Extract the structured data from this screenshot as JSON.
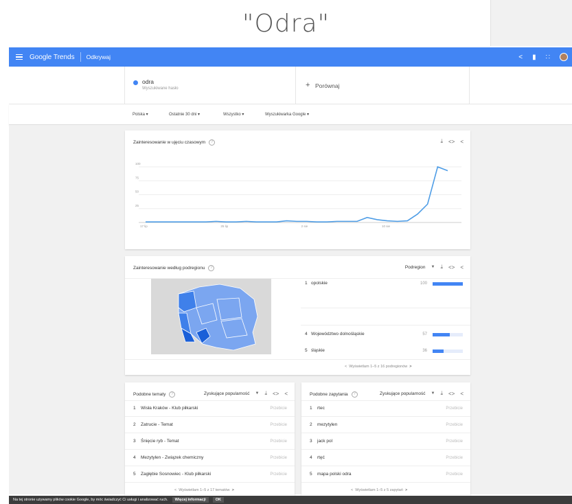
{
  "slide_title": "\"Odra\"",
  "app": {
    "brand": "Google Trends",
    "section": "Odkrywaj"
  },
  "search": {
    "term": "odra",
    "term_type": "Wyszukiwane hasło",
    "compare_label": "Porównaj"
  },
  "filters": {
    "region": "Polska ▾",
    "period": "Ostatnie 30 dni ▾",
    "category": "Wszystko ▾",
    "source": "Wyszukiwarka Google ▾"
  },
  "time_card": {
    "title": "Zainteresowanie w ujęciu czasowym"
  },
  "chart_data": {
    "type": "line",
    "x_tick_labels": [
      "17 lip",
      "25 lip",
      "2 sie",
      "10 sie"
    ],
    "y_tick_labels": [
      "100",
      "75",
      "50",
      "25"
    ],
    "ylim": [
      0,
      100
    ],
    "grid": true,
    "series": [
      {
        "color": "#4e9de6",
        "values": [
          1,
          1,
          1,
          1,
          1,
          1,
          1,
          2,
          1,
          1,
          2,
          1,
          1,
          1,
          3,
          2,
          2,
          1,
          1,
          2,
          2,
          2,
          9,
          5,
          3,
          2,
          3,
          15,
          33,
          100,
          93
        ]
      }
    ]
  },
  "region_card": {
    "title": "Zainteresowanie według podregionu",
    "mode_label": "Podregion",
    "rows": [
      {
        "rank": "1",
        "name": "opolskie",
        "value": "100",
        "fraction": 1.0
      },
      {
        "rank": "4",
        "name": "Województwo dolnośląskie",
        "value": "57",
        "fraction": 0.57
      },
      {
        "rank": "5",
        "name": "śląskie",
        "value": "36",
        "fraction": 0.36
      }
    ],
    "pager": "Wyświetlam 1–5 z 16 podregionów"
  },
  "topics_card": {
    "title": "Podobne tematy",
    "mode_label": "Zyskujące popularność",
    "rows": [
      {
        "rank": "1",
        "name": "Wisła Kraków - Klub piłkarski",
        "badge": "Przebicie"
      },
      {
        "rank": "2",
        "name": "Zatrucie - Temat",
        "badge": "Przebicie"
      },
      {
        "rank": "3",
        "name": "Śnięcie ryb - Temat",
        "badge": "Przebicie"
      },
      {
        "rank": "4",
        "name": "Mezytylen - Związek chemiczny",
        "badge": "Przebicie"
      },
      {
        "rank": "5",
        "name": "Zagłębie Sosnowiec - Klub piłkarski",
        "badge": "Przebicie"
      }
    ],
    "pager": "Wyświetlam 1–5 z 17 tematów"
  },
  "queries_card": {
    "title": "Podobne zapytania",
    "mode_label": "Zyskujące popularność",
    "rows": [
      {
        "rank": "1",
        "name": "rtec",
        "badge": "Przebicie"
      },
      {
        "rank": "2",
        "name": "mezytylen",
        "badge": "Przebicie"
      },
      {
        "rank": "3",
        "name": "jack pol",
        "badge": "Przebicie"
      },
      {
        "rank": "4",
        "name": "rtęć",
        "badge": "Przebicie"
      },
      {
        "rank": "5",
        "name": "mapa polski odra",
        "badge": "Przebicie"
      }
    ],
    "pager": "Wyświetlam 1–5 z 5 zapytań"
  },
  "cookie": {
    "text": "Na tej stronie używamy plików cookie Google, by móc świadczyć Ci usługi i analizować ruch.",
    "more": "Więcej informacji",
    "ok": "OK"
  },
  "colors": {
    "brand_blue": "#4285f4",
    "map_base": "#7ba6f0",
    "map_dark": "#1a5fd8",
    "map_mid": "#3f80ea"
  }
}
